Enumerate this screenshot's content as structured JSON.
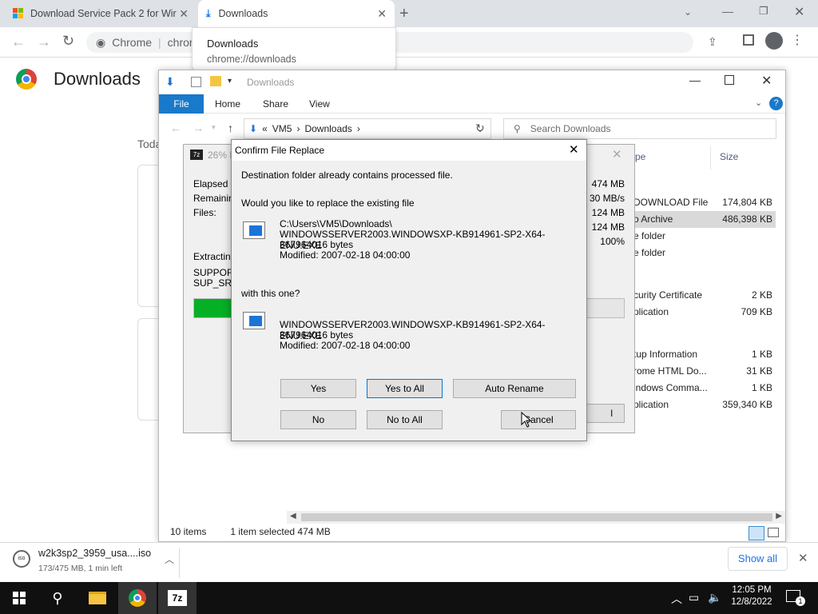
{
  "chrome": {
    "tabs": [
      {
        "title": "Download Service Pack 2 for Wir"
      },
      {
        "title": "Downloads"
      }
    ],
    "omnibox": {
      "label": "Chrome",
      "separator": "|",
      "url_fragment": "chrom"
    },
    "tooltip": {
      "title": "Downloads",
      "url": "chrome://downloads"
    },
    "page_title": "Downloads",
    "today_label": "Toda"
  },
  "explorer": {
    "title": "Downloads",
    "ribbon_tabs": [
      "File",
      "Home",
      "Share",
      "View"
    ],
    "breadcrumb": [
      "VM5",
      "Downloads"
    ],
    "breadcrumb_prefix": "«",
    "search_placeholder": "Search Downloads",
    "columns": {
      "type": "pe",
      "size": "Size"
    },
    "rows": [
      {
        "type": "DOWNLOAD File",
        "size": "174,804 KB"
      },
      {
        "type": "o Archive",
        "size": "486,398 KB",
        "selected": true
      },
      {
        "type": "e folder",
        "size": ""
      },
      {
        "type": "e folder",
        "size": ""
      },
      {
        "type": "curity Certificate",
        "size": "2 KB"
      },
      {
        "type": "plication",
        "size": "709 KB"
      },
      {
        "type": "tup Information",
        "size": "1 KB"
      },
      {
        "type": "rome HTML Do...",
        "size": "31 KB"
      },
      {
        "type": "indows Comma...",
        "size": "1 KB"
      },
      {
        "type": "plication",
        "size": "359,340 KB"
      }
    ],
    "status": {
      "items": "10 items",
      "selected": "1 item selected  474 MB"
    }
  },
  "sevenzip": {
    "title": "26% E",
    "labels": [
      "Elapsed tin",
      "Remaining",
      "Files:",
      "Extracting",
      "SUPPORT",
      "SUP_SRV"
    ],
    "values": [
      "474 MB",
      "30 MB/s",
      "124 MB",
      "124 MB",
      "100%"
    ],
    "progress": 0.26
  },
  "dialog": {
    "title": "Confirm File Replace",
    "line1": "Destination folder already contains processed file.",
    "line2": "Would you like to replace the existing file",
    "existing": {
      "path": "C:\\Users\\VM5\\Downloads\\",
      "name": "WINDOWSSERVER2003.WINDOWSXP-KB914961-SP2-X64-ENU.EXE",
      "size": "367964016 bytes",
      "modified": "Modified: 2007-02-18 04:00:00"
    },
    "with_label": "with this one?",
    "new": {
      "name": "WINDOWSSERVER2003.WINDOWSXP-KB914961-SP2-X64-ENU.EXE",
      "size": "367964016 bytes",
      "modified": "Modified: 2007-02-18 04:00:00"
    },
    "buttons": {
      "yes": "Yes",
      "yes_all": "Yes to All",
      "auto_rename": "Auto Rename",
      "no": "No",
      "no_all": "No to All",
      "cancel": "Cancel"
    }
  },
  "shelf": {
    "filename": "w2k3sp2_3959_usa....iso",
    "progress": "173/475 MB, 1 min left",
    "show_all": "Show all"
  },
  "taskbar": {
    "time": "12:05 PM",
    "date": "12/8/2022",
    "notification_count": "1"
  }
}
